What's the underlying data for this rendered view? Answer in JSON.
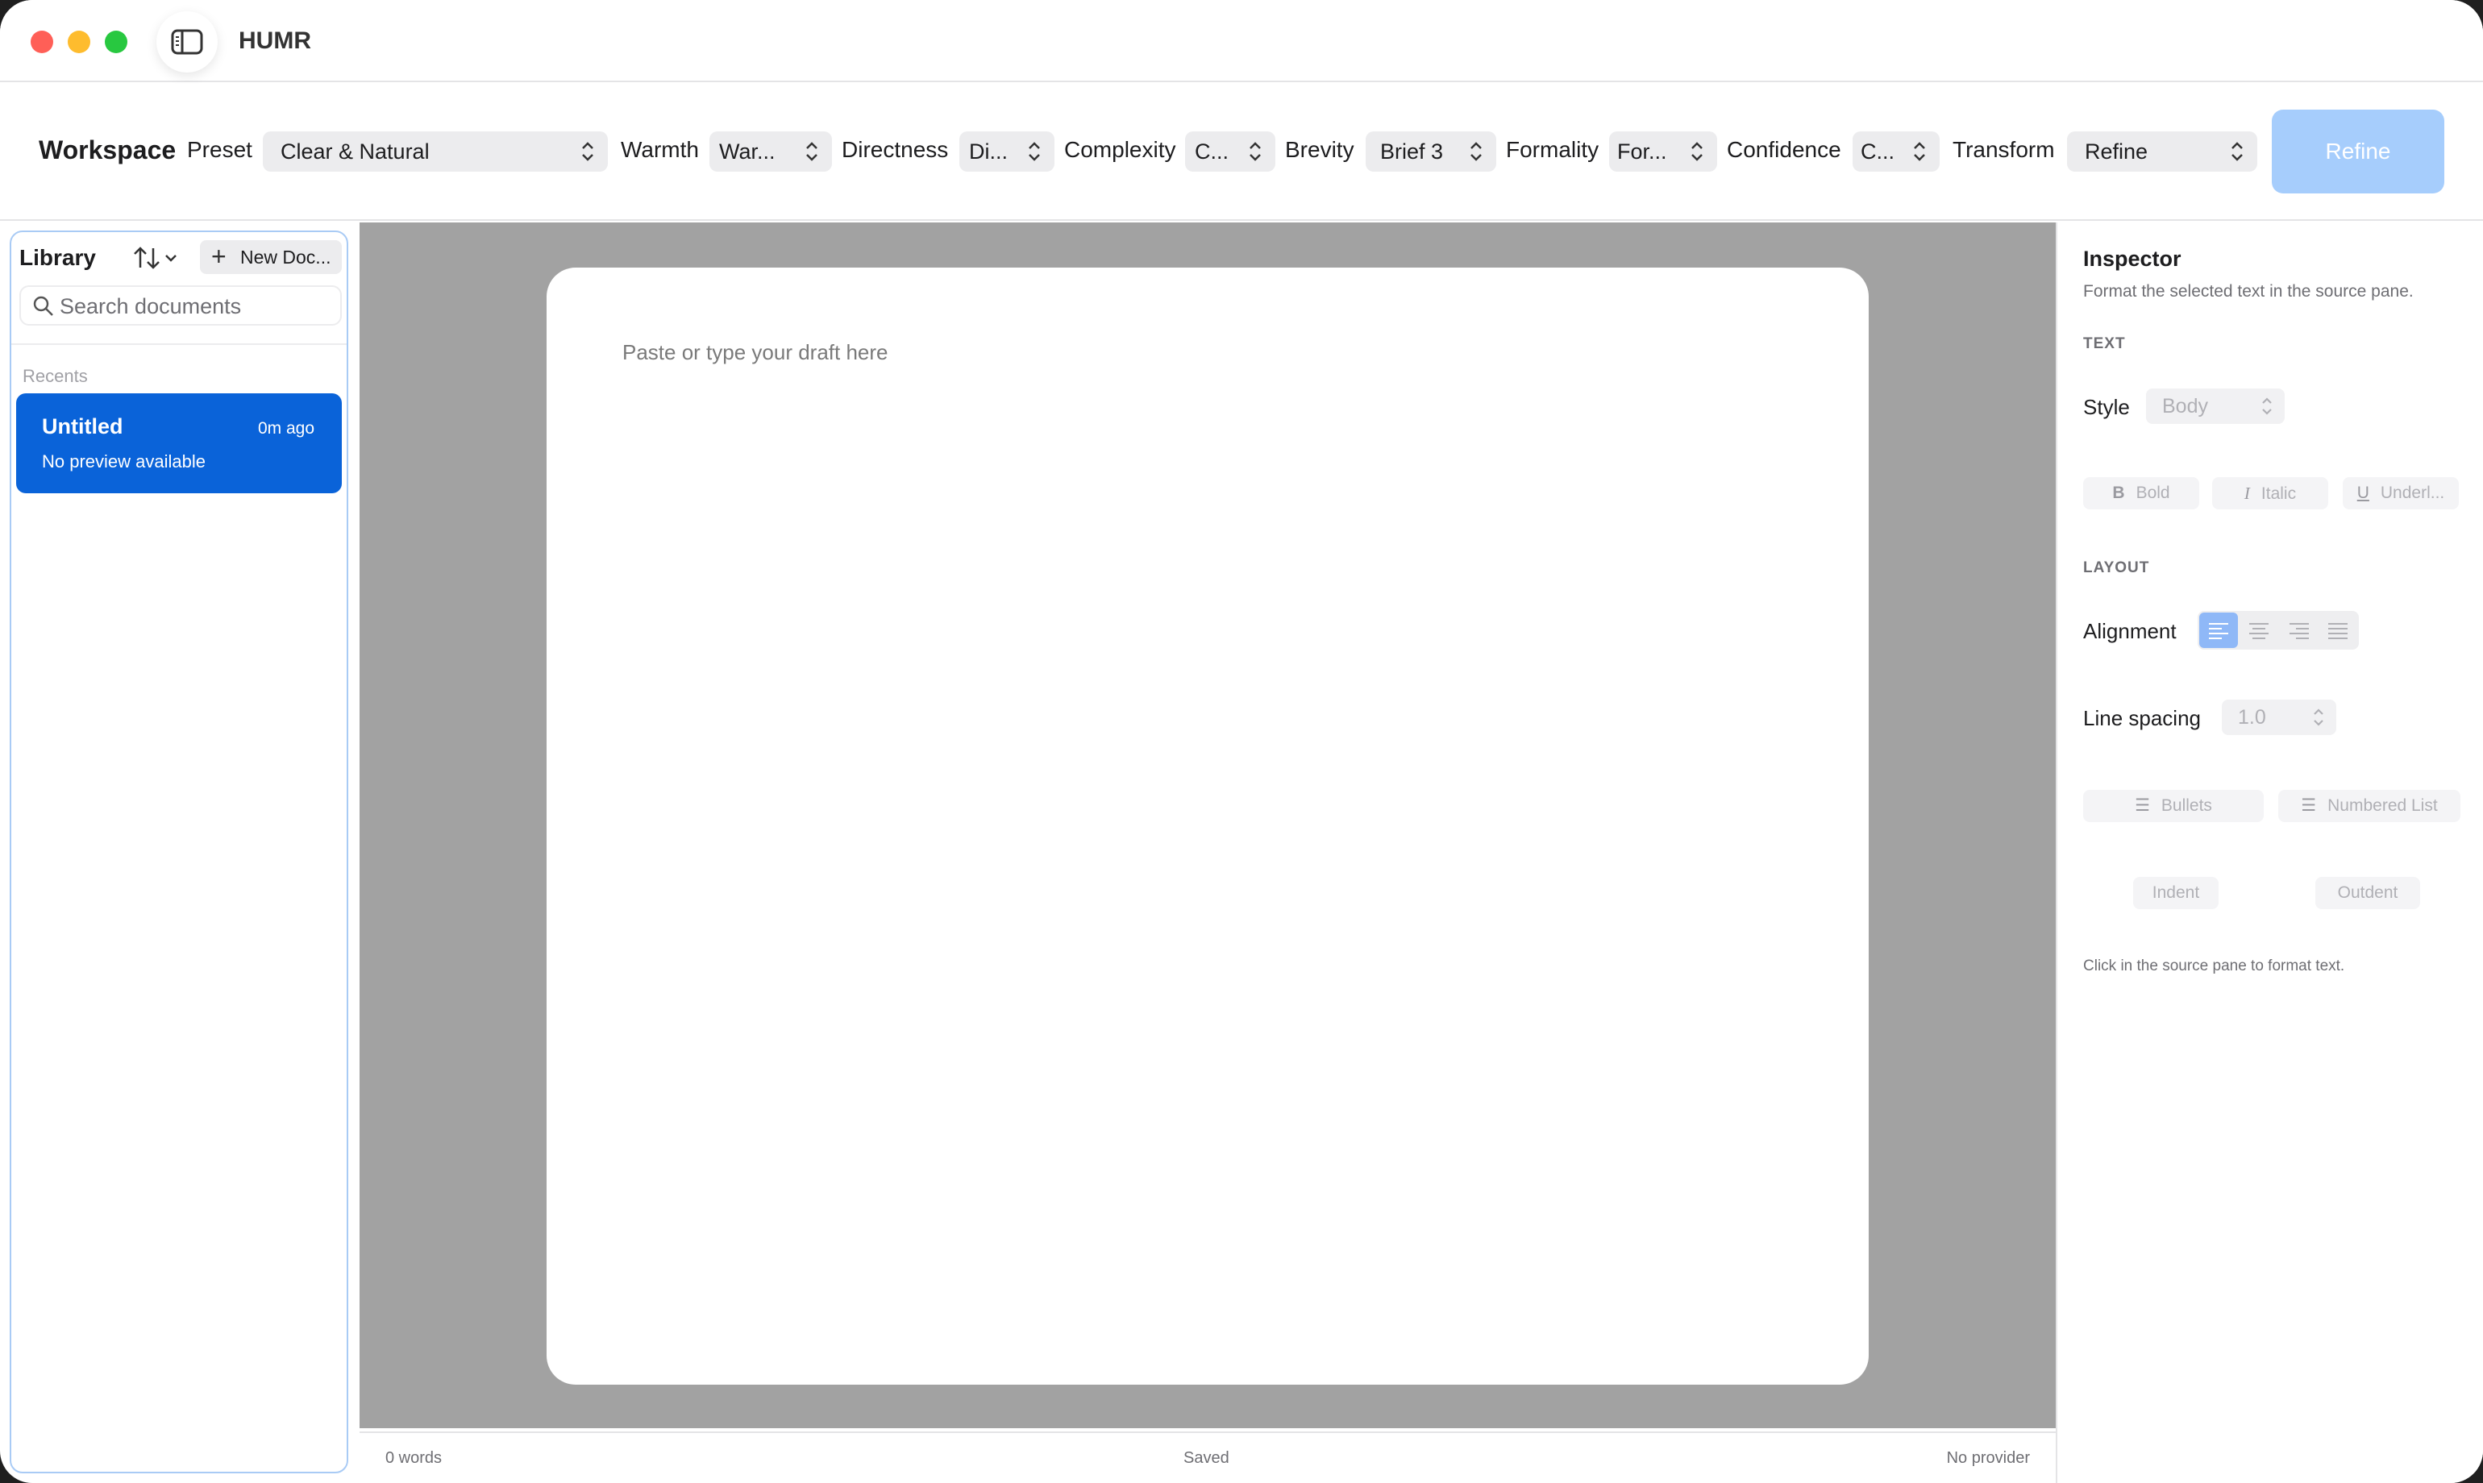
{
  "window": {
    "app_title": "HUMR"
  },
  "toolbar": {
    "workspace_label": "Workspace",
    "preset_label": "Preset",
    "preset_value": "Clear & Natural",
    "warmth_label": "Warmth",
    "warmth_value": "War...",
    "directness_label": "Directness",
    "directness_value": "Di...",
    "complexity_label": "Complexity",
    "complexity_value": "C...",
    "brevity_label": "Brevity",
    "brevity_value": "Brief 3",
    "formality_label": "Formality",
    "formality_value": "For...",
    "confidence_label": "Confidence",
    "confidence_value": "C...",
    "transform_label": "Transform",
    "transform_value": "Refine",
    "refine_button": "Refine"
  },
  "library": {
    "title": "Library",
    "new_doc_label": "New Doc...",
    "search_placeholder": "Search documents",
    "recents_label": "Recents",
    "documents": [
      {
        "title": "Untitled",
        "time": "0m ago",
        "preview": "No preview available"
      }
    ]
  },
  "editor": {
    "placeholder": "Paste or type your draft here"
  },
  "status": {
    "words": "0 words",
    "save_state": "Saved",
    "provider": "No provider"
  },
  "inspector": {
    "title": "Inspector",
    "subtitle": "Format the selected text in the source pane.",
    "text_section": "TEXT",
    "style_label": "Style",
    "style_value": "Body",
    "bold_label": "Bold",
    "italic_label": "Italic",
    "underline_label": "Underl...",
    "layout_section": "LAYOUT",
    "alignment_label": "Alignment",
    "line_spacing_label": "Line spacing",
    "line_spacing_value": "1.0",
    "bullets_label": "Bullets",
    "numbered_label": "Numbered List",
    "indent_label": "Indent",
    "outdent_label": "Outdent",
    "hint": "Click in the source pane to format text."
  },
  "colors": {
    "accent": "#0a63d9",
    "refine_button_disabled": "#a6cdfc",
    "editor_background": "#a2a2a2",
    "library_border": "#a9cbf5"
  },
  "icons": [
    "sidebar-toggle-icon",
    "sort-icon",
    "plus-icon",
    "search-icon",
    "chevron-updown-icon",
    "align-left-icon",
    "align-center-icon",
    "align-right-icon",
    "align-justify-icon",
    "list-bullet-icon",
    "list-number-icon"
  ]
}
